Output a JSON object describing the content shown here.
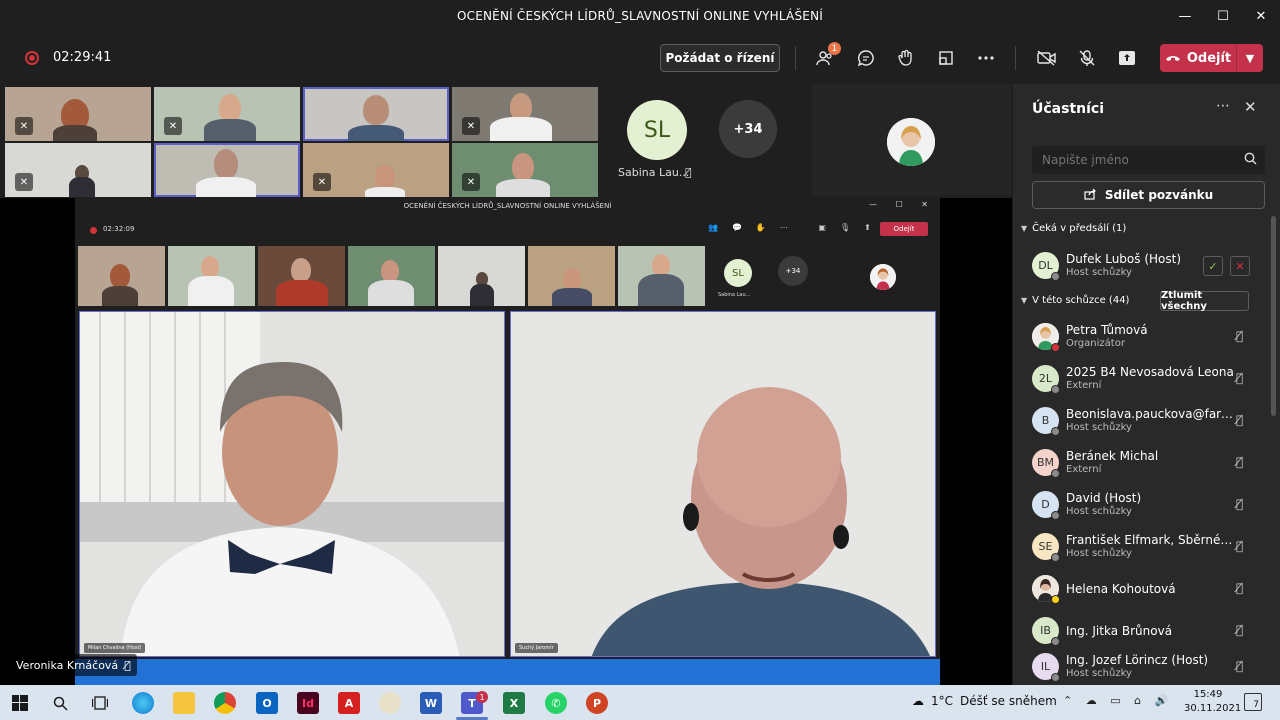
{
  "window": {
    "title": "OCENĚNÍ ČESKÝCH LÍDRŮ_SLAVNOSTNÍ ONLINE VYHLÁŠENÍ",
    "controls": {
      "minimize": "—",
      "maximize": "☐",
      "close": "✕"
    }
  },
  "toolbar": {
    "recording_time": "02:29:41",
    "request_control_label": "Požádat o řízení",
    "participants_badge": "1",
    "leave_label": "Odejít",
    "icons": [
      "participants-icon",
      "chat-icon",
      "reactions-icon",
      "rooms-icon",
      "more-icon",
      "camera-off-icon",
      "mic-off-icon",
      "share-icon"
    ]
  },
  "gallery": {
    "sabina_initials": "SL",
    "sabina_name": "Sabina Lau...",
    "more_count": "+34"
  },
  "shared_screen": {
    "title": "OCENĚNÍ ČESKÝCH LÍDRŮ_SLAVNOSTNÍ ONLINE VYHLÁŠENÍ",
    "recording_time": "02:32:09",
    "leave_label": "Odejít",
    "sl_initials": "SL",
    "sl_name": "Sabina Lau...",
    "more_count": "+34",
    "left_video_label": "Milan Chvalina (Host)",
    "right_video_label": "Suchý Jaromír"
  },
  "presenter": {
    "name": "Veronika Krnáčová"
  },
  "panel": {
    "title": "Účastníci",
    "search_placeholder": "Napište jméno",
    "share_invite_label": "Sdílet pozvánku",
    "lobby_section": "Čeká v předsálí (1)",
    "meeting_section": "V této schůzce (44)",
    "mute_all_label": "Ztlumit všechny",
    "lobby": [
      {
        "initials": "DL",
        "name": "Dufek Luboš (Host)",
        "role": "Host schůzky",
        "color": "#e3f1d2"
      }
    ],
    "people": [
      {
        "initials": "",
        "name": "Petra Tůmová",
        "role": "Organizátor",
        "color": "#f6d9c8"
      },
      {
        "initials": "2L",
        "name": "2025 B4 Nevosadová Leona",
        "role": "Externí",
        "color": "#d8e9c9"
      },
      {
        "initials": "B",
        "name": "Beonislava.pauckova@farmak...",
        "role": "Host schůzky",
        "color": "#d5e3f3"
      },
      {
        "initials": "BM",
        "name": "Beránek Michal",
        "role": "Externí",
        "color": "#f5d3cd"
      },
      {
        "initials": "D",
        "name": "David (Host)",
        "role": "Host schůzky",
        "color": "#d5e3f3"
      },
      {
        "initials": "SE",
        "name": "František Elfmark, Sběrné sur...",
        "role": "Host schůzky",
        "color": "#f8e5c2"
      },
      {
        "initials": "",
        "name": "Helena Kohoutová",
        "role": "",
        "color": "#e9d7c9"
      },
      {
        "initials": "IB",
        "name": "Ing. Jitka Brůnová",
        "role": "",
        "color": "#d8e9c9"
      },
      {
        "initials": "IL",
        "name": "Ing. Jozef Lörincz (Host)",
        "role": "Host schůzky",
        "color": "#e6dbef"
      }
    ]
  },
  "taskbar": {
    "weather_temp": "1°C",
    "weather_text": "Déšť se sněhem",
    "time": "15:49",
    "date": "30.11.2021",
    "notifications": "7",
    "teams_badge": "1",
    "apps": [
      "start-icon",
      "search-icon",
      "task-view-icon",
      "edge-icon",
      "explorer-icon",
      "chrome-icon",
      "outlook-icon",
      "indesign-icon",
      "acrobat-icon",
      "paint-icon",
      "word-icon",
      "teams-icon",
      "excel-icon",
      "whatsapp-icon",
      "powerpoint-icon"
    ]
  }
}
